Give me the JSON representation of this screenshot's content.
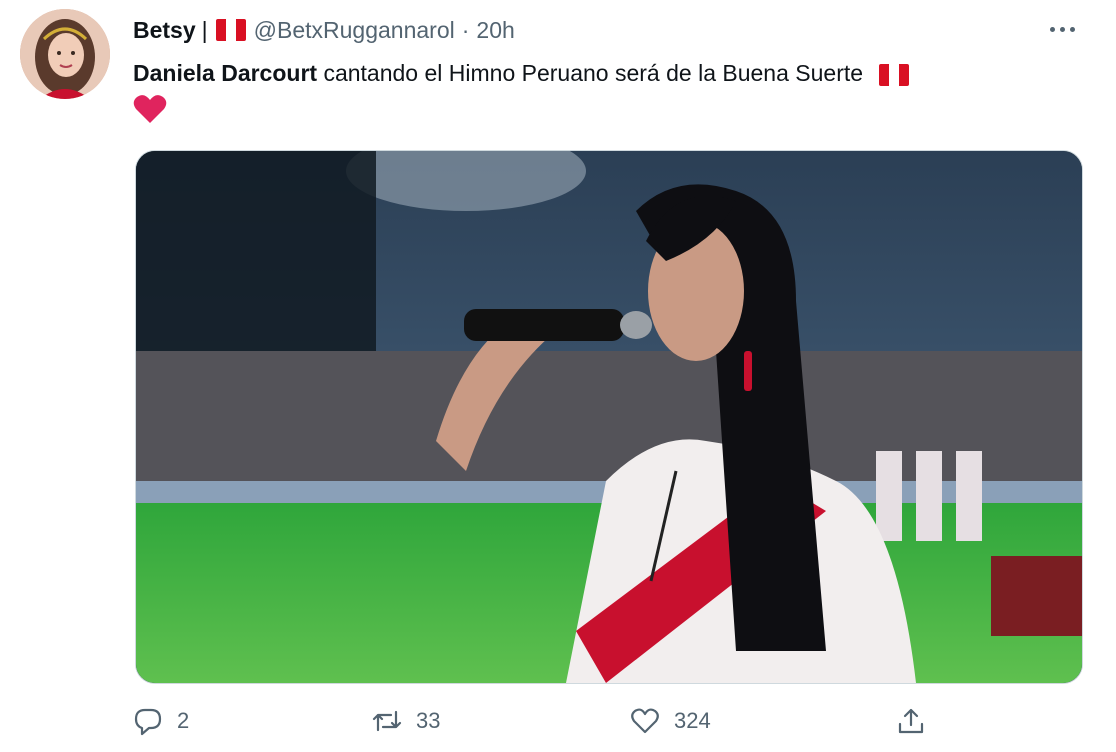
{
  "tweet": {
    "author_name": "Betsy",
    "separator": "|",
    "handle": "@BetxRuggannarol",
    "dot": "·",
    "time": "20h",
    "text_bold": "Daniela Darcourt",
    "text_rest": " cantando el Himno Peruano será de la Buena Suerte",
    "media_icon": "peru-flag-emoji",
    "trailing_icon": "red-heart-emoji"
  },
  "actions": {
    "reply_count": "2",
    "retweet_count": "33",
    "like_count": "324"
  },
  "colors": {
    "text": "#0f1419",
    "muted": "#536471",
    "flag_red": "#d91023",
    "heart_red": "#e0245e"
  }
}
